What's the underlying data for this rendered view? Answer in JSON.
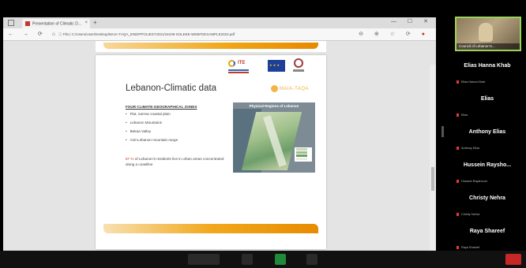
{
  "browser": {
    "tab_title": "Presentation of Climatic D...",
    "tab_close": "×",
    "tab_new": "+",
    "window_controls": "— ☐ ✕",
    "nav_buttons": "← → ⟳ ⌂",
    "url": "ⓘ File | C:/Users/User/Desktop/MAIA-TAQA_ENIEPPOLIEST2021/16109-SOLEEE-WEBFDEXAMPLE2022.pdf",
    "tool_icons": "⊖ ⊕ ☆ ⟳"
  },
  "slide": {
    "title": "Lebanon-Climatic data",
    "brand": "MAIA-TAQA",
    "logo_text": "ITE",
    "zones_heading": "FOUR CLIMATE-GEOGRAPHICAL ZONES",
    "zones": [
      "Flat, narrow coastal plain",
      "Lebanon Mountains",
      "Bekaa Valley",
      "Anti-Lebanon mountain range"
    ],
    "note_pct": "87 %",
    "note_text": " of Lebanon's residents live in urban areas concentrated along a coastline",
    "map_title": "Physical Regions of Lebanon"
  },
  "video": {
    "caption": "Council of Lebanon's..."
  },
  "participants": [
    {
      "name": "Elias Hanna Khab",
      "sub": "Elias Hanna Khab"
    },
    {
      "name": "Elias",
      "sub": "Elias"
    },
    {
      "name": "Anthony Elias",
      "sub": "Anthony Elias"
    },
    {
      "name": "Hussein Raysho...",
      "sub": "Hussein Rayshouni"
    },
    {
      "name": "Christy Nehra",
      "sub": "Christy Nehra"
    },
    {
      "name": "Raya Shareef",
      "sub": "Raya Shareef"
    }
  ],
  "more_button": "⌄",
  "colors": {
    "accent_orange": "#f0a514",
    "video_border": "#9cd15a",
    "mic_muted": "#e53935"
  }
}
